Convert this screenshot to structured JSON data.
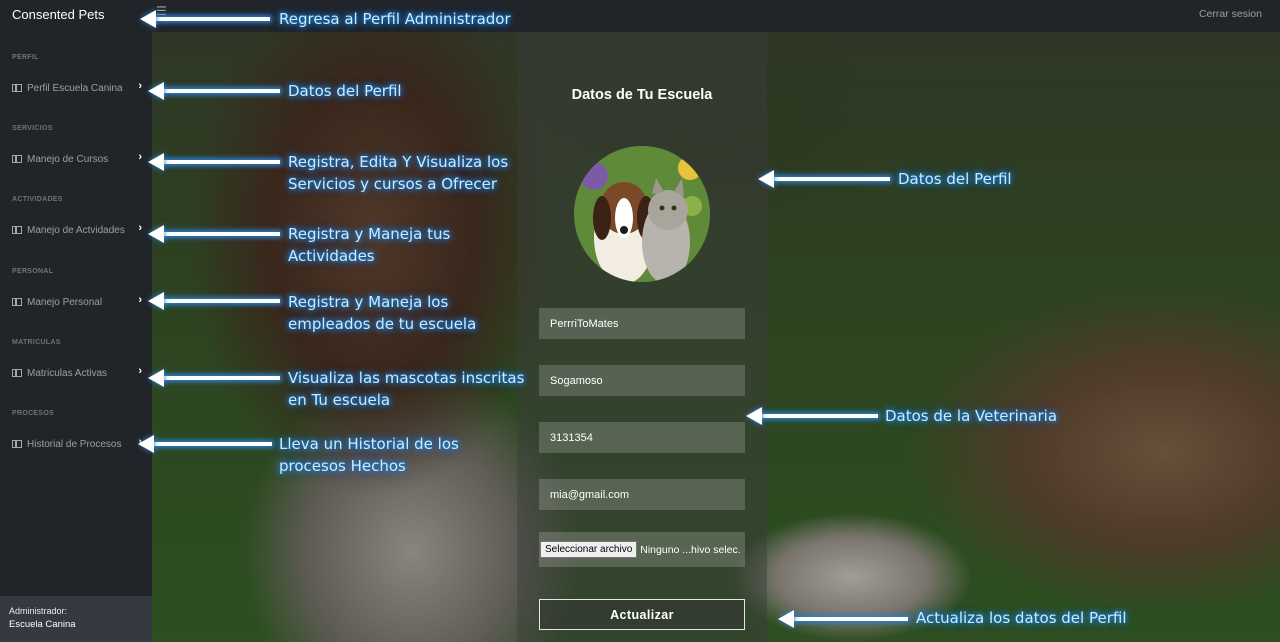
{
  "topbar": {
    "brand": "Consented Pets",
    "toggle_icon": "hamburger-icon",
    "logout": "Cerrar sesion"
  },
  "sidebar": {
    "sections": [
      {
        "heading": "PERFIL",
        "item": "Perfil Escuela Canina"
      },
      {
        "heading": "SERVICIOS",
        "item": "Manejo de Cursos"
      },
      {
        "heading": "ACTIVIDADES",
        "item": "Manejo de Actvidades"
      },
      {
        "heading": "PERSONAL",
        "item": "Manejo Personal"
      },
      {
        "heading": "MATRICULAS",
        "item": "Matriculas Activas"
      },
      {
        "heading": "PROCESOS",
        "item": "Historial de Procesos"
      }
    ],
    "footer": {
      "label": "Administrador:",
      "name": "Escuela Canina"
    }
  },
  "form": {
    "title": "Datos de Tu Escuela",
    "fields": [
      "PerrriToMates",
      "Sogamoso",
      "3131354",
      "mia@gmail.com"
    ],
    "file_button": "Seleccionar archivo",
    "file_status": "Ninguno ...hivo selec.",
    "submit": "Actualizar"
  },
  "annotations": [
    "Regresa al Perfil Administrador",
    "Datos del Perfil",
    "Registra, Edita Y Visualiza los",
    "Servicios y cursos a Ofrecer",
    "Registra y Maneja tus",
    "Actividades",
    "Registra y Maneja los",
    "empleados de tu escuela",
    "Visualiza las mascotas inscritas",
    "en Tu escuela",
    "Lleva un Historial de los",
    "procesos Hechos",
    "Datos del Perfil",
    "Datos de la Veterinaria",
    "Actualiza los datos del Perfil"
  ]
}
